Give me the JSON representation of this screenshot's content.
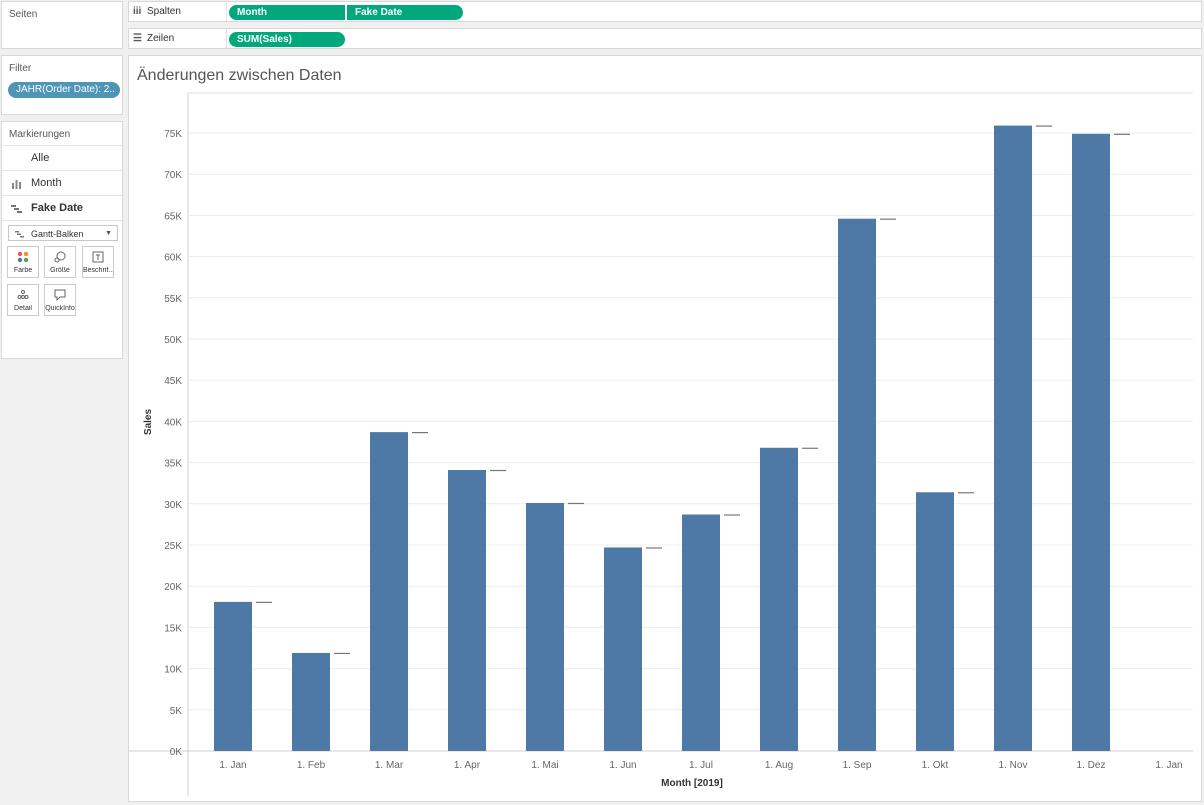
{
  "sidebar": {
    "pages_title": "Seiten",
    "filter_title": "Filter",
    "filter_pill": "JAHR(Order Date): 2..",
    "marks_title": "Markierungen",
    "marks_rows": [
      {
        "label": "Alle",
        "icon": "none"
      },
      {
        "label": "Month",
        "icon": "bar-chart-icon"
      },
      {
        "label": "Fake Date",
        "icon": "gantt-icon"
      }
    ],
    "mark_type": "Gantt-Balken",
    "buttons": [
      {
        "label": "Farbe",
        "icon": "color-icon"
      },
      {
        "label": "Größe",
        "icon": "size-icon"
      },
      {
        "label": "Beschrif...",
        "icon": "label-icon"
      },
      {
        "label": "Detail",
        "icon": "detail-icon"
      },
      {
        "label": "QuickInfo",
        "icon": "tooltip-icon"
      }
    ]
  },
  "shelves": {
    "columns_label": "Spalten",
    "columns_pills": [
      "Month",
      "Fake Date"
    ],
    "rows_label": "Zeilen",
    "rows_pills": [
      "SUM(Sales)"
    ]
  },
  "colors": {
    "pill_green": "#00a87c",
    "filter_blue": "#4e95b8",
    "bar_blue": "#4e79a7"
  },
  "chart_data": {
    "type": "bar",
    "title": "Änderungen zwischen Daten",
    "xlabel": "Month [2019]",
    "ylabel": "Sales",
    "categories": [
      "1. Jan",
      "1. Feb",
      "1. Mar",
      "1. Apr",
      "1. Mai",
      "1. Jun",
      "1. Jul",
      "1. Aug",
      "1. Sep",
      "1. Okt",
      "1. Nov",
      "1. Dez"
    ],
    "x_tick_labels": [
      "1. Jan",
      "1. Feb",
      "1. Mar",
      "1. Apr",
      "1. Mai",
      "1. Jun",
      "1. Jul",
      "1. Aug",
      "1. Sep",
      "1. Okt",
      "1. Nov",
      "1. Dez",
      "1. Jan"
    ],
    "values": [
      18100,
      11900,
      38700,
      34100,
      30100,
      24700,
      28700,
      36800,
      64600,
      31400,
      75900,
      74900
    ],
    "ylim": [
      0,
      77500
    ],
    "y_ticks": [
      0,
      5000,
      10000,
      15000,
      20000,
      25000,
      30000,
      35000,
      40000,
      45000,
      50000,
      55000,
      60000,
      65000,
      70000,
      75000
    ],
    "y_tick_labels": [
      "0K",
      "5K",
      "10K",
      "15K",
      "20K",
      "25K",
      "30K",
      "35K",
      "40K",
      "45K",
      "50K",
      "55K",
      "60K",
      "65K",
      "70K",
      "75K"
    ],
    "grid": true
  }
}
